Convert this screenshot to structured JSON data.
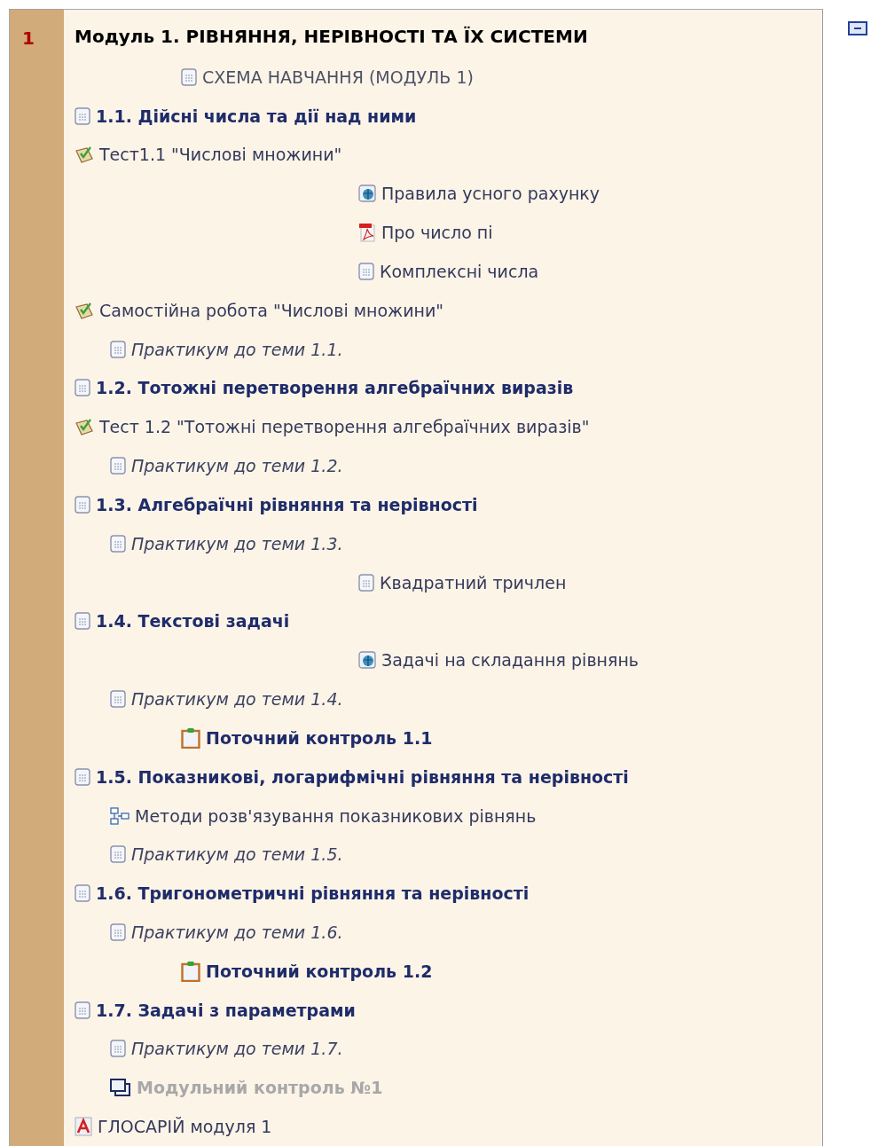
{
  "section": {
    "number": "1",
    "title": "Модуль 1. РІВНЯННЯ, НЕРІВНОСТІ ТА ЇХ СИСТЕМИ",
    "items": [
      {
        "kind": "intro",
        "text": "СХЕМА НАВЧАННЯ (МОДУЛЬ 1)"
      },
      {
        "kind": "topic",
        "text": "1.1. Дійсні числа та дії над ними"
      },
      {
        "kind": "quiz",
        "text": "Тест1.1 \"Числові множини\""
      },
      {
        "kind": "weblink",
        "text": "Правила усного рахунку"
      },
      {
        "kind": "pdf",
        "text": "Про число пі"
      },
      {
        "kind": "note",
        "text": "Комплексні числа"
      },
      {
        "kind": "quiz",
        "text": "Самостійна робота \"Числові множини\""
      },
      {
        "kind": "practicum",
        "text": "Практикум до теми 1.1."
      },
      {
        "kind": "topic",
        "text": "1.2. Тотожні перетворення алгебраїчних виразів"
      },
      {
        "kind": "quiz",
        "text": "Тест 1.2 \"Тотожні перетворення алгебраїчних виразів\""
      },
      {
        "kind": "practicum",
        "text": "Практикум до теми 1.2."
      },
      {
        "kind": "topic",
        "text": "1.3. Алгебраїчні рівняння та нерівності"
      },
      {
        "kind": "practicum",
        "text": "Практикум до теми 1.3."
      },
      {
        "kind": "note",
        "text": "Квадратний тричлен"
      },
      {
        "kind": "topic",
        "text": "1.4. Текстові задачі"
      },
      {
        "kind": "weblink",
        "text": "Задачі на складання рівнянь"
      },
      {
        "kind": "practicum",
        "text": "Практикум до теми 1.4."
      },
      {
        "kind": "assignment",
        "text": "Поточний контроль 1.1"
      },
      {
        "kind": "topic",
        "text": "1.5. Показникові, логарифмічні рівняння та нерівності"
      },
      {
        "kind": "mindmap",
        "text": "Методи розв'язування показникових рівнянь"
      },
      {
        "kind": "practicum",
        "text": "Практикум до теми 1.5."
      },
      {
        "kind": "topic",
        "text": "1.6. Тригонометричні рівняння та нерівності"
      },
      {
        "kind": "practicum",
        "text": "Практикум до теми 1.6."
      },
      {
        "kind": "assignment",
        "text": "Поточний контроль 1.2"
      },
      {
        "kind": "topic",
        "text": "1.7. Задачі з параметрами"
      },
      {
        "kind": "practicum",
        "text": "Практикум до теми 1.7."
      },
      {
        "kind": "hidden",
        "text": "Модульний контроль №1"
      },
      {
        "kind": "glossary",
        "text": "ГЛОСАРІЙ модуля 1"
      }
    ]
  }
}
